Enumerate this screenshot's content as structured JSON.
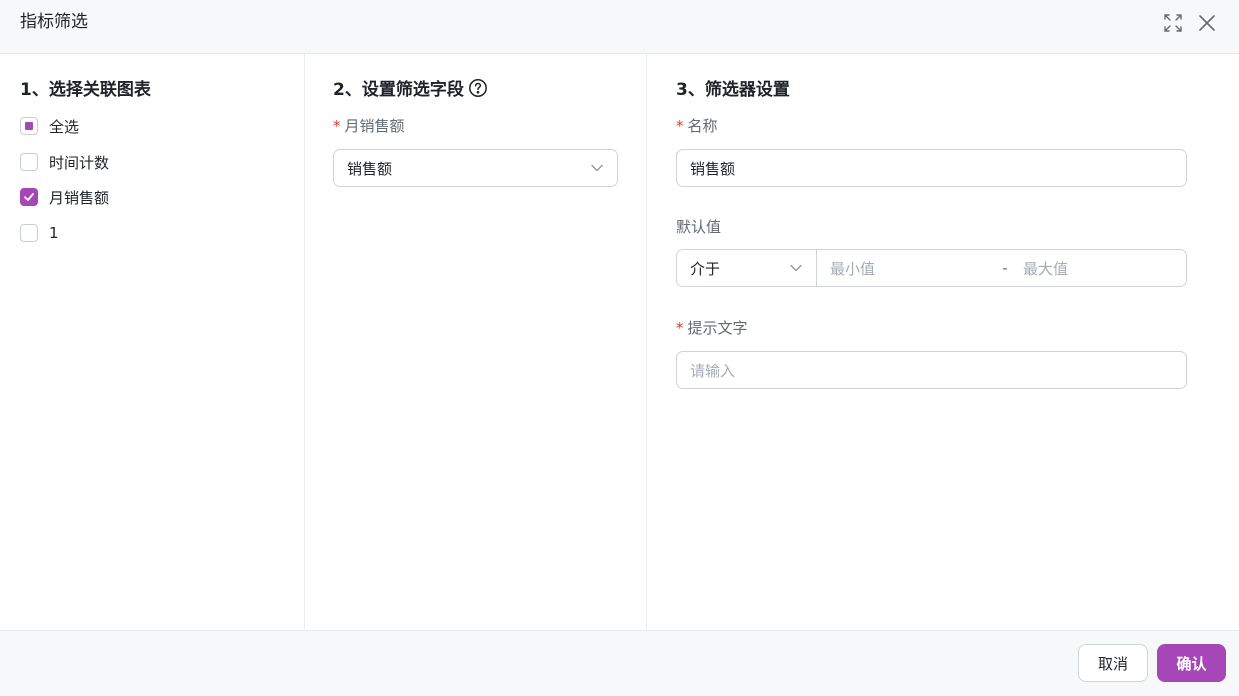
{
  "dialog": {
    "title": "指标筛选"
  },
  "section1": {
    "title": "1、选择关联图表",
    "items": [
      {
        "label": "全选",
        "state": "indeterminate"
      },
      {
        "label": "时间计数",
        "state": "unchecked"
      },
      {
        "label": "月销售额",
        "state": "checked"
      },
      {
        "label": "1",
        "state": "unchecked"
      }
    ]
  },
  "section2": {
    "title": "2、设置筛选字段",
    "field_label": "月销售额",
    "field_value": "销售额"
  },
  "section3": {
    "title": "3、筛选器设置",
    "name_label": "名称",
    "name_value": "销售额",
    "default_label": "默认值",
    "range_type": "介于",
    "min_placeholder": "最小值",
    "range_separator": "-",
    "max_placeholder": "最大值",
    "hint_label": "提示文字",
    "hint_placeholder": "请输入"
  },
  "footer": {
    "cancel_label": "取消",
    "ok_label": "确认"
  },
  "colors": {
    "accent": "#a647b8",
    "required": "#d83931"
  },
  "icons": [
    "fullscreen-icon",
    "close-icon",
    "help-circle-icon",
    "chevron-down-icon",
    "check-icon"
  ]
}
